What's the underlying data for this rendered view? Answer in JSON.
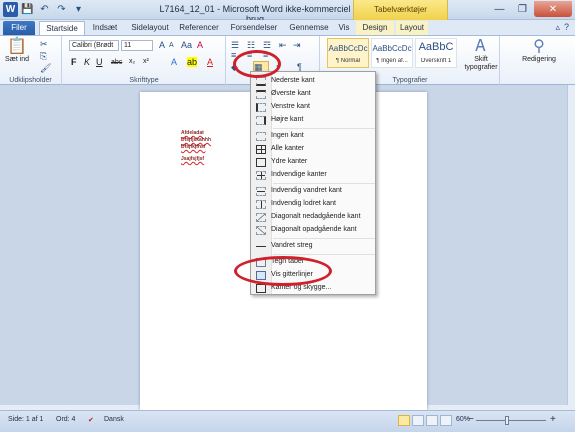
{
  "window": {
    "title": "L7164_12_01 - Microsoft Word ikke-kommerciel brug",
    "context_tab_group": "Tabelværktøjer",
    "min_icon": "minimize-icon",
    "max_icon": "maximize-icon",
    "close_icon": "close-icon"
  },
  "quick_access": {
    "app_icon": "W",
    "save_icon": "💾",
    "undo_icon": "↶",
    "redo_icon": "↷",
    "more_icon": "▾"
  },
  "tabs": [
    {
      "label": "Filer"
    },
    {
      "label": "Startside"
    },
    {
      "label": "Indsæt"
    },
    {
      "label": "Sidelayout"
    },
    {
      "label": "Referencer"
    },
    {
      "label": "Forsendelser"
    },
    {
      "label": "Gennemse"
    },
    {
      "label": "Vis"
    },
    {
      "label": "Design"
    },
    {
      "label": "Layout"
    }
  ],
  "ribbon": {
    "clipboard": {
      "paste_label": "Sæt ind",
      "group_label": "Udklipsholder"
    },
    "font": {
      "font_name": "Calibri (Brødt",
      "font_size": "11",
      "group_label": "Skrifttype",
      "bold": "F",
      "italic": "K",
      "underline": "U",
      "strike": "abc",
      "sub": "x₂",
      "sup": "x²",
      "grow": "A",
      "shrink": "A",
      "aa": "Aa",
      "clear": "A"
    },
    "paragraph": {
      "pilcrow": "¶"
    },
    "styles": {
      "group_label": "Typografier",
      "tiles": [
        {
          "preview": "AaBbCcDc",
          "name": "¶ Normal"
        },
        {
          "preview": "AaBbCcDc",
          "name": "¶ Ingen af..."
        },
        {
          "preview": "AaBbC",
          "name": "Overskrift 1"
        }
      ],
      "change_styles": "Skift typografier",
      "editing": "Redigering"
    }
  },
  "document": {
    "lines": [
      "Afdeladat",
      "Dfsjfjskahhh",
      "Dfsjfkjfhsf",
      "Jsajfsjfjsf"
    ]
  },
  "border_menu": {
    "items": [
      {
        "label": "Nederste kant",
        "icon": "bottom-border-icon"
      },
      {
        "label": "Øverste kant",
        "icon": "top-border-icon"
      },
      {
        "label": "Venstre kant",
        "icon": "left-border-icon"
      },
      {
        "label": "Højre kant",
        "icon": "right-border-icon"
      },
      {
        "label": "Ingen kant",
        "icon": "no-border-icon"
      },
      {
        "label": "Alle kanter",
        "icon": "all-borders-icon"
      },
      {
        "label": "Ydre kanter",
        "icon": "outside-borders-icon"
      },
      {
        "label": "Indvendige kanter",
        "icon": "inside-borders-icon"
      },
      {
        "label": "Indvendig vandret kant",
        "icon": "inside-horizontal-border-icon"
      },
      {
        "label": "Indvendig lodret kant",
        "icon": "inside-vertical-border-icon"
      },
      {
        "label": "Diagonalt nedadgående kant",
        "icon": "diagonal-down-border-icon"
      },
      {
        "label": "Diagonalt opadgående kant",
        "icon": "diagonal-up-border-icon"
      },
      {
        "label": "Vandret streg",
        "icon": "horizontal-line-icon"
      },
      {
        "label": "Tegn tabel",
        "icon": "draw-table-icon"
      },
      {
        "label": "Vis gitterlinjer",
        "icon": "view-gridlines-icon"
      },
      {
        "label": "Kanter og skygge...",
        "icon": "borders-shading-icon"
      }
    ]
  },
  "statusbar": {
    "page": "Side: 1 af 1",
    "words": "Ord: 4",
    "language": "Dansk",
    "zoom": "60%",
    "zoom_out": "−",
    "zoom_in": "+"
  }
}
